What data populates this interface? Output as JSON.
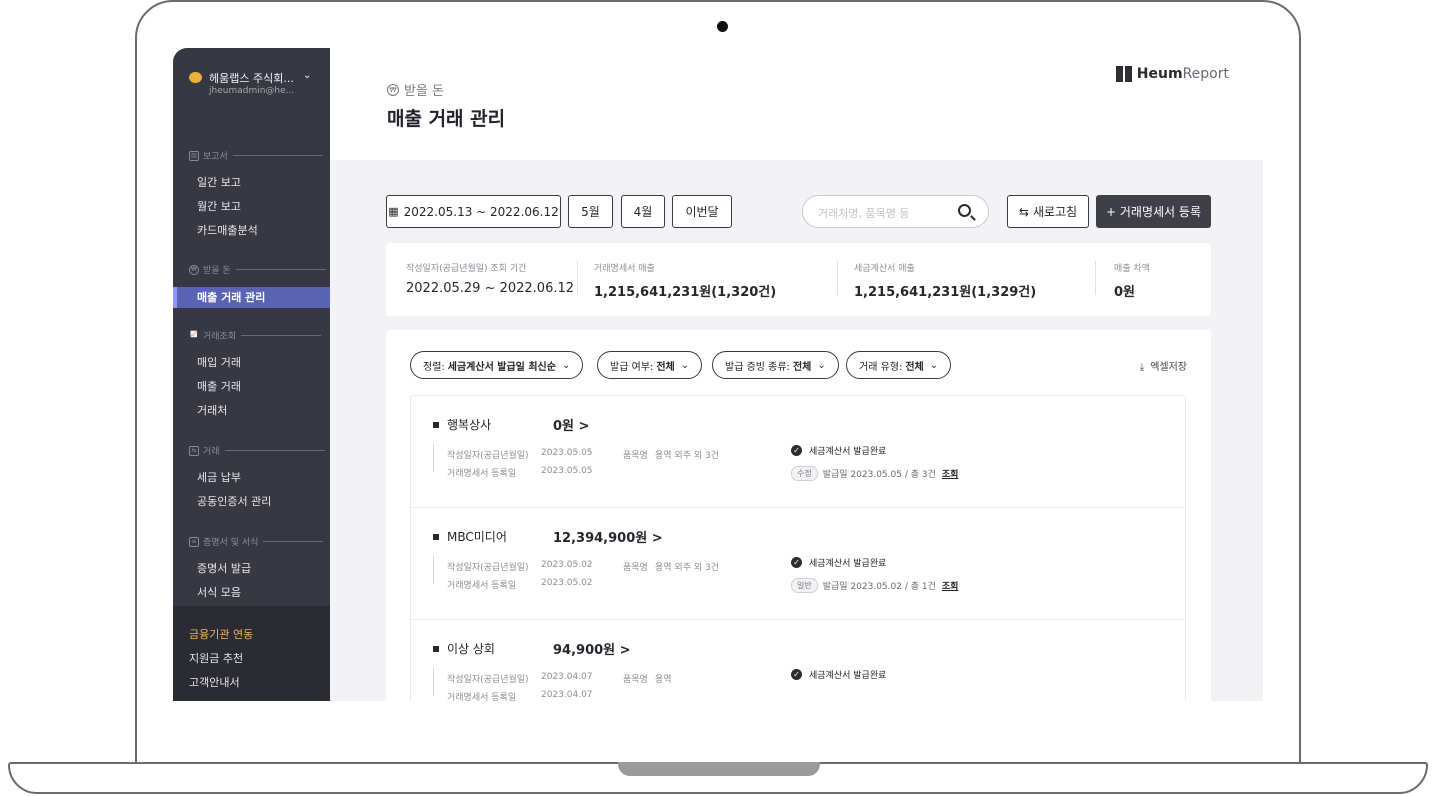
{
  "sidebar": {
    "company_name": "헤움랩스 주식회...",
    "company_email": "jheumadmin@he...",
    "sections": [
      {
        "label": "보고서",
        "items": [
          "일간 보고",
          "월간 보고",
          "카드매출분석"
        ]
      },
      {
        "label": "받을 돈",
        "items": [
          "매출 거래 관리"
        ]
      },
      {
        "label": "거래조회",
        "items": [
          "매입 거래",
          "매출 거래",
          "거래처"
        ]
      },
      {
        "label": "거래",
        "items": [
          "세금 납부",
          "공동인증서 관리"
        ]
      },
      {
        "label": "증명서 및 서식",
        "items": [
          "증명서 발급",
          "서식 모음"
        ]
      }
    ],
    "bottom_items": [
      "금융기관 연동",
      "지원금 추천",
      "고객안내서"
    ]
  },
  "header": {
    "breadcrumb": "받을 돈",
    "title": "매출 거래 관리",
    "brand_bold": "Heum",
    "brand_light": "Report"
  },
  "toolbar": {
    "date_range": "2022.05.13 ~ 2022.06.12",
    "btn_may": "5월",
    "btn_april": "4월",
    "btn_this_month": "이번달",
    "search_placeholder": "거래처명, 품목명 등",
    "refresh": "새로고침",
    "register": "+ 거래명세서 등록"
  },
  "summary": {
    "period_label": "작성일자(공급년월일) 조회 기간",
    "period_value": "2022.05.29 ~ 2022.06.12",
    "statement_label": "거래명세서 매출",
    "statement_value": "1,215,641,231원(1,320건)",
    "tax_label": "세금계산서 매출",
    "tax_value": "1,215,641,231원(1,329건)",
    "diff_label": "매출 차액",
    "diff_value": "0원"
  },
  "filters": {
    "sort_prefix": "정렬:",
    "sort_value": "세금계산서 발급일 최신순",
    "issue_prefix": "발급 여부:",
    "issue_value": "전체",
    "proof_prefix": "발급 증빙 종류:",
    "proof_value": "전체",
    "type_prefix": "거래 유형:",
    "type_value": "전체",
    "excel": "엑셀저장"
  },
  "rows": [
    {
      "name": "행복상사",
      "amount": "0원 >",
      "date_label": "작성일자(공급년월일)",
      "date_value": "2023.05.05",
      "reg_label": "거래명세서 등록일",
      "reg_value": "2023.05.05",
      "item_label": "품목명",
      "item_value": "용역 외주 외 3건",
      "status": "세금계산서 발급완료",
      "tag": "수정",
      "issue_text": "발급일 2023.05.05 / 총 3건",
      "link": "조회"
    },
    {
      "name": "MBC미디어",
      "amount": "12,394,900원 >",
      "date_label": "작성일자(공급년월일)",
      "date_value": "2023.05.02",
      "reg_label": "거래명세서 등록일",
      "reg_value": "2023.05.02",
      "item_label": "품목명",
      "item_value": "용역 외주 외 3건",
      "status": "세금계산서 발급완료",
      "tag": "일반",
      "issue_text": "발급일 2023.05.02 / 총 1건",
      "link": "조회"
    },
    {
      "name": "이상 상회",
      "amount": "94,900원 >",
      "date_label": "작성일자(공급년월일)",
      "date_value": "2023.04.07",
      "reg_label": "거래명세서 등록일",
      "reg_value": "2023.04.07",
      "item_label": "품목명",
      "item_value": "용역",
      "status": "세금계산서 발급완료"
    }
  ],
  "colors": {
    "sidebar_bg": "#383842",
    "active_item": "#5b64b3",
    "accent_orange": "#f0b35c",
    "dark_button": "#3f3f47"
  }
}
